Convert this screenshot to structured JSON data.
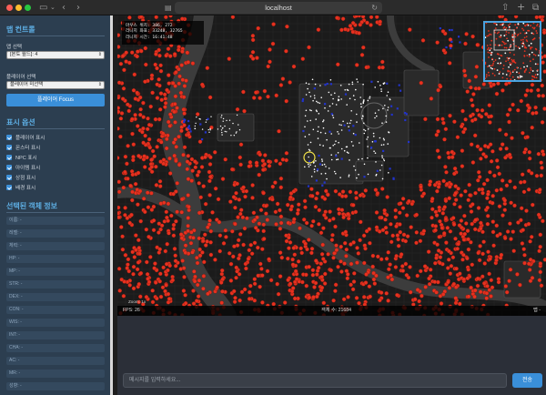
{
  "browser": {
    "url": "localhost",
    "icons": {
      "sidebar": "sidebar-icon",
      "back": "back-icon",
      "forward": "forward-icon",
      "shield": "shield-icon",
      "reload": "reload-icon",
      "share": "share-icon",
      "new_tab": "plus-icon",
      "tabs": "tabs-icon",
      "page": "page-icon"
    }
  },
  "sidebar": {
    "map_controls_title": "맵 컨트롤",
    "map_select_label": "맵 선택",
    "map_select_value": "[본토 월드]: 4",
    "player_select_label": "플레이어 선택",
    "player_select_value": "플레이어 미선택",
    "focus_button": "플레이어 Focus",
    "display_options_title": "표시 옵션",
    "display_options": [
      {
        "label": "플레이어 표시",
        "checked": true
      },
      {
        "label": "몬스터 표시",
        "checked": true
      },
      {
        "label": "NPC 표시",
        "checked": true
      },
      {
        "label": "아이템 표시",
        "checked": true
      },
      {
        "label": "상점 표시",
        "checked": true
      },
      {
        "label": "배경 표시",
        "checked": true
      }
    ],
    "selected_info_title": "선택된 객체 정보",
    "info_fields": [
      "이름: -",
      "레벨: -",
      "체력: -",
      "HP: -",
      "MP: -",
      "STR: -",
      "DEX: -",
      "CON: -",
      "WIS: -",
      "INT: -",
      "CHA: -",
      "AC: -",
      "MR: -",
      "성향: -"
    ]
  },
  "map": {
    "info_lines": [
      "마우스 위치: 386, 272",
      "리니지 좌표: 33248, 32765",
      "리니지 시간: 16:41:48"
    ],
    "zoom_label": "Zoom: 1x",
    "fps": "FPS: 26",
    "entity_count": "객체 수: 21684",
    "bottom_right": "맵 -",
    "colors": {
      "monster": "#e8311f",
      "npc": "#2233cc",
      "item": "#ffffff",
      "background": "#1b1b1b",
      "minimap_border": "#4aa3df"
    }
  },
  "chat": {
    "placeholder": "메시지를 입력하세요...",
    "send_label": "전송"
  }
}
